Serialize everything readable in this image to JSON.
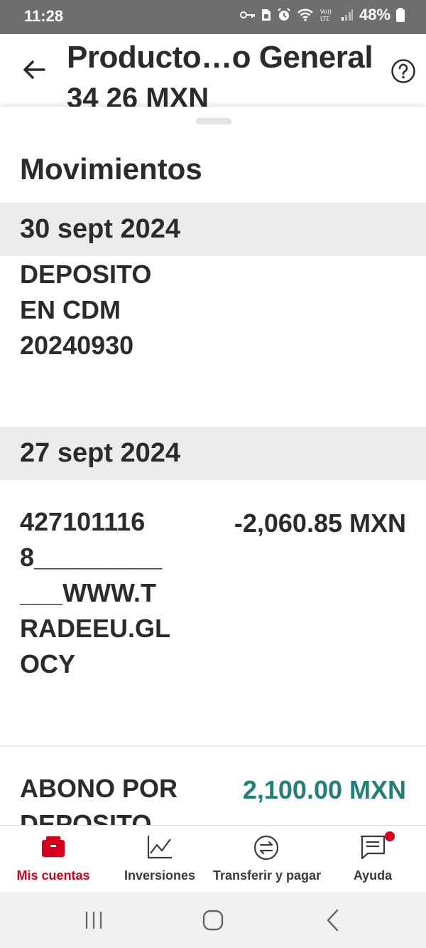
{
  "status_bar": {
    "time": "11:28",
    "battery": "48%",
    "icons": [
      "key-icon",
      "sim-icon",
      "alarm-icon",
      "wifi-icon",
      "volte-icon",
      "signal-icon",
      "battery-icon"
    ]
  },
  "header": {
    "title": "Producto…o General",
    "subtitle": "34 26 MXN",
    "back_icon": "arrow-left-icon",
    "help_icon": "question-circle-icon"
  },
  "movements": {
    "title": "Movimientos",
    "groups": [
      {
        "date": "30 sept 2024",
        "transactions": [
          {
            "description_lines": [
              "DEPOSITO",
              "EN CDM",
              "20240930"
            ],
            "amount": "",
            "type": "neutral"
          }
        ]
      },
      {
        "date": "27 sept 2024",
        "transactions": [
          {
            "description_lines": [
              "427101116",
              "8_________",
              "___WWW.T",
              "RADEEU.GL",
              "OCY"
            ],
            "amount": "-2,060.85 MXN",
            "type": "debit"
          },
          {
            "description_lines": [
              "ABONO POR",
              "DEPOSITO"
            ],
            "amount": "2,100.00 MXN",
            "type": "credit"
          }
        ]
      }
    ]
  },
  "bottom_nav": {
    "items": [
      {
        "label": "Mis cuentas",
        "icon": "wallet-icon",
        "active": true
      },
      {
        "label": "Inversiones",
        "icon": "chart-line-icon",
        "active": false
      },
      {
        "label": "Transferir y pagar",
        "icon": "transfer-icon",
        "active": false
      },
      {
        "label": "Ayuda",
        "icon": "chat-icon",
        "active": false,
        "notification": true
      }
    ]
  },
  "system_nav": {
    "buttons": [
      "recents-icon",
      "home-icon",
      "back-icon"
    ]
  },
  "colors": {
    "accent": "#d6001c",
    "credit": "#238078",
    "band": "#ececec",
    "text": "#2b2b2b"
  }
}
